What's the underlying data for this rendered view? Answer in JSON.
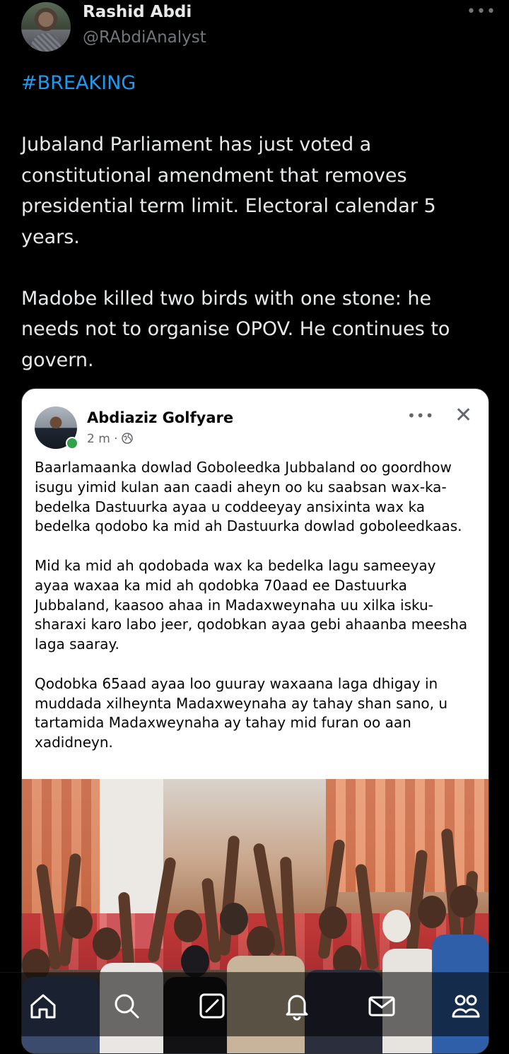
{
  "tweet": {
    "author_name": "Rashid Abdi",
    "author_handle": "@RAbdiAnalyst",
    "more_label": "•••",
    "hashtag": "#BREAKING",
    "paragraph_1": "Jubaland Parliament has just voted a constitutional amendment that removes presidential term limit. Electoral calendar 5 years.",
    "paragraph_2": "Madobe killed two birds with one stone: he needs not to organise OPOV. He continues to govern."
  },
  "embedded_post": {
    "author_name": "Abdiaziz Golfyare",
    "time": "2 m ·",
    "more_label": "•••",
    "close_label": "✕",
    "paragraphs": [
      "Baarlamaanka dowlad Goboleedka Jubbaland  oo goordhow isugu yimid kulan aan caadi aheyn oo ku saabsan wax-ka-bedelka Dastuurka ayaa u coddeeyay ansixinta wax ka bedelka qodobo ka mid ah Dastuurka dowlad goboleedkaas.",
      "Mid ka mid ah qodobada wax ka bedelka lagu sameeyay ayaa waxaa ka mid ah qodobka 70aad ee Dastuurka Jubbaland, kaasoo ahaa in Madaxweynaha uu xilka isku-sharaxi karo labo jeer, qodobkan ayaa gebi ahaanba meesha laga saaray.",
      "Qodobka 65aad ayaa loo guuray waxaana laga dhigay in muddada xilheynta Madaxweynaha ay tahay shan sano, u tartamida Madaxweynaha ay tahay mid furan oo aan xadidneyn."
    ]
  },
  "bottom_nav": {
    "items": [
      "home-icon",
      "search-icon",
      "compose-icon",
      "notifications-icon",
      "messages-icon",
      "communities-icon"
    ]
  }
}
